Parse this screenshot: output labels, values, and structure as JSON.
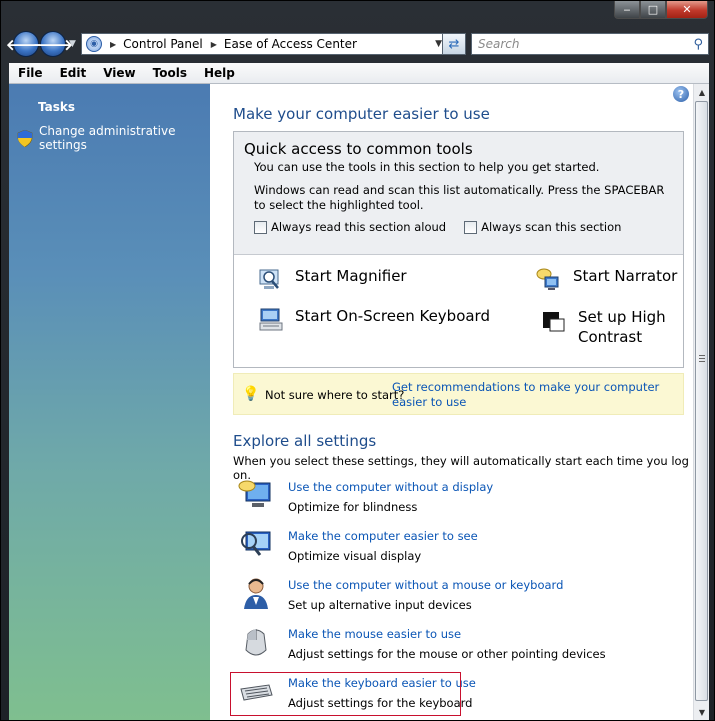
{
  "window": {
    "caption_buttons": {
      "minimize": "‒",
      "maximize": "□",
      "close": "✕"
    }
  },
  "address_bar": {
    "back_icon": "back-arrow-icon",
    "forward_icon": "forward-arrow-icon",
    "breadcrumbs": [
      "Control Panel",
      "Ease of Access Center"
    ],
    "search_placeholder": "Search"
  },
  "menu": [
    "File",
    "Edit",
    "View",
    "Tools",
    "Help"
  ],
  "sidebar": {
    "title": "Tasks",
    "items": [
      {
        "label": "Change administrative settings",
        "icon": "uac-shield-icon"
      }
    ]
  },
  "main": {
    "heading": "Make your computer easier to use",
    "quick_access": {
      "title": "Quick access to common tools",
      "intro": "You can use the tools in this section to help you get started.",
      "scan_text": "Windows can read and scan this list automatically.  Press the SPACEBAR to select the highlighted tool.",
      "checkboxes": [
        {
          "label": "Always read this section aloud",
          "checked": false
        },
        {
          "label": "Always scan this section",
          "checked": false
        }
      ],
      "tools": {
        "magnifier": "Start Magnifier",
        "narrator": "Start Narrator",
        "keyboard": "Start On-Screen Keyboard",
        "contrast_line1": "Set up High",
        "contrast_line2": "Contrast"
      }
    },
    "tip": {
      "label": "Not sure where to start?",
      "link": "Get recommendations to make your computer easier to use"
    },
    "explore": {
      "heading": "Explore all settings",
      "description": "When you select these settings, they will automatically start each time you log on.",
      "settings": [
        {
          "link": "Use the computer without a display",
          "desc": "Optimize for blindness"
        },
        {
          "link": "Make the computer easier to see",
          "desc": "Optimize visual display"
        },
        {
          "link": "Use the computer without a mouse or keyboard",
          "desc": "Set up alternative input devices"
        },
        {
          "link": "Make the mouse easier to use",
          "desc": "Adjust settings for the mouse or other pointing devices"
        },
        {
          "link": "Make the keyboard easier to use",
          "desc": "Adjust settings for the keyboard"
        }
      ]
    }
  },
  "colors": {
    "link": "#0a55b5",
    "heading": "#1f4d8c",
    "highlight_border": "#c8102e",
    "tip_background": "#fbf8d3"
  }
}
